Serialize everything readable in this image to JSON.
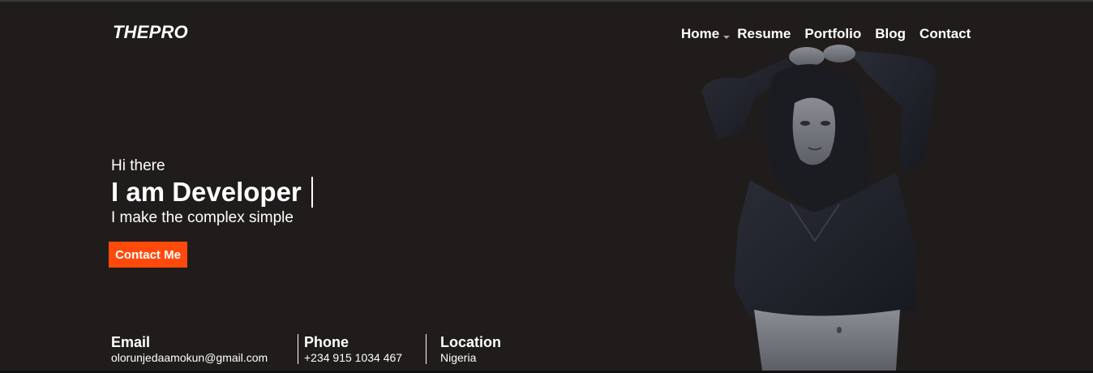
{
  "brand": {
    "logo": "THEPRO"
  },
  "nav": {
    "items": [
      {
        "label": "Home",
        "has_dropdown": true
      },
      {
        "label": "Resume"
      },
      {
        "label": "Portfolio"
      },
      {
        "label": "Blog"
      },
      {
        "label": "Contact"
      }
    ]
  },
  "hero": {
    "greeting": "Hi there",
    "headline": "I am Developer",
    "tagline": "I make the complex simple",
    "cta_label": "Contact Me"
  },
  "info": {
    "email": {
      "label": "Email",
      "value": "olorunjedaamokun@gmail.com"
    },
    "phone": {
      "label": "Phone",
      "value": "+234 915 1034 467"
    },
    "location": {
      "label": "Location",
      "value": "Nigeria"
    }
  },
  "theme": {
    "background": "#201c1c",
    "accent": "#ff4a0c",
    "text": "#ffffff"
  }
}
